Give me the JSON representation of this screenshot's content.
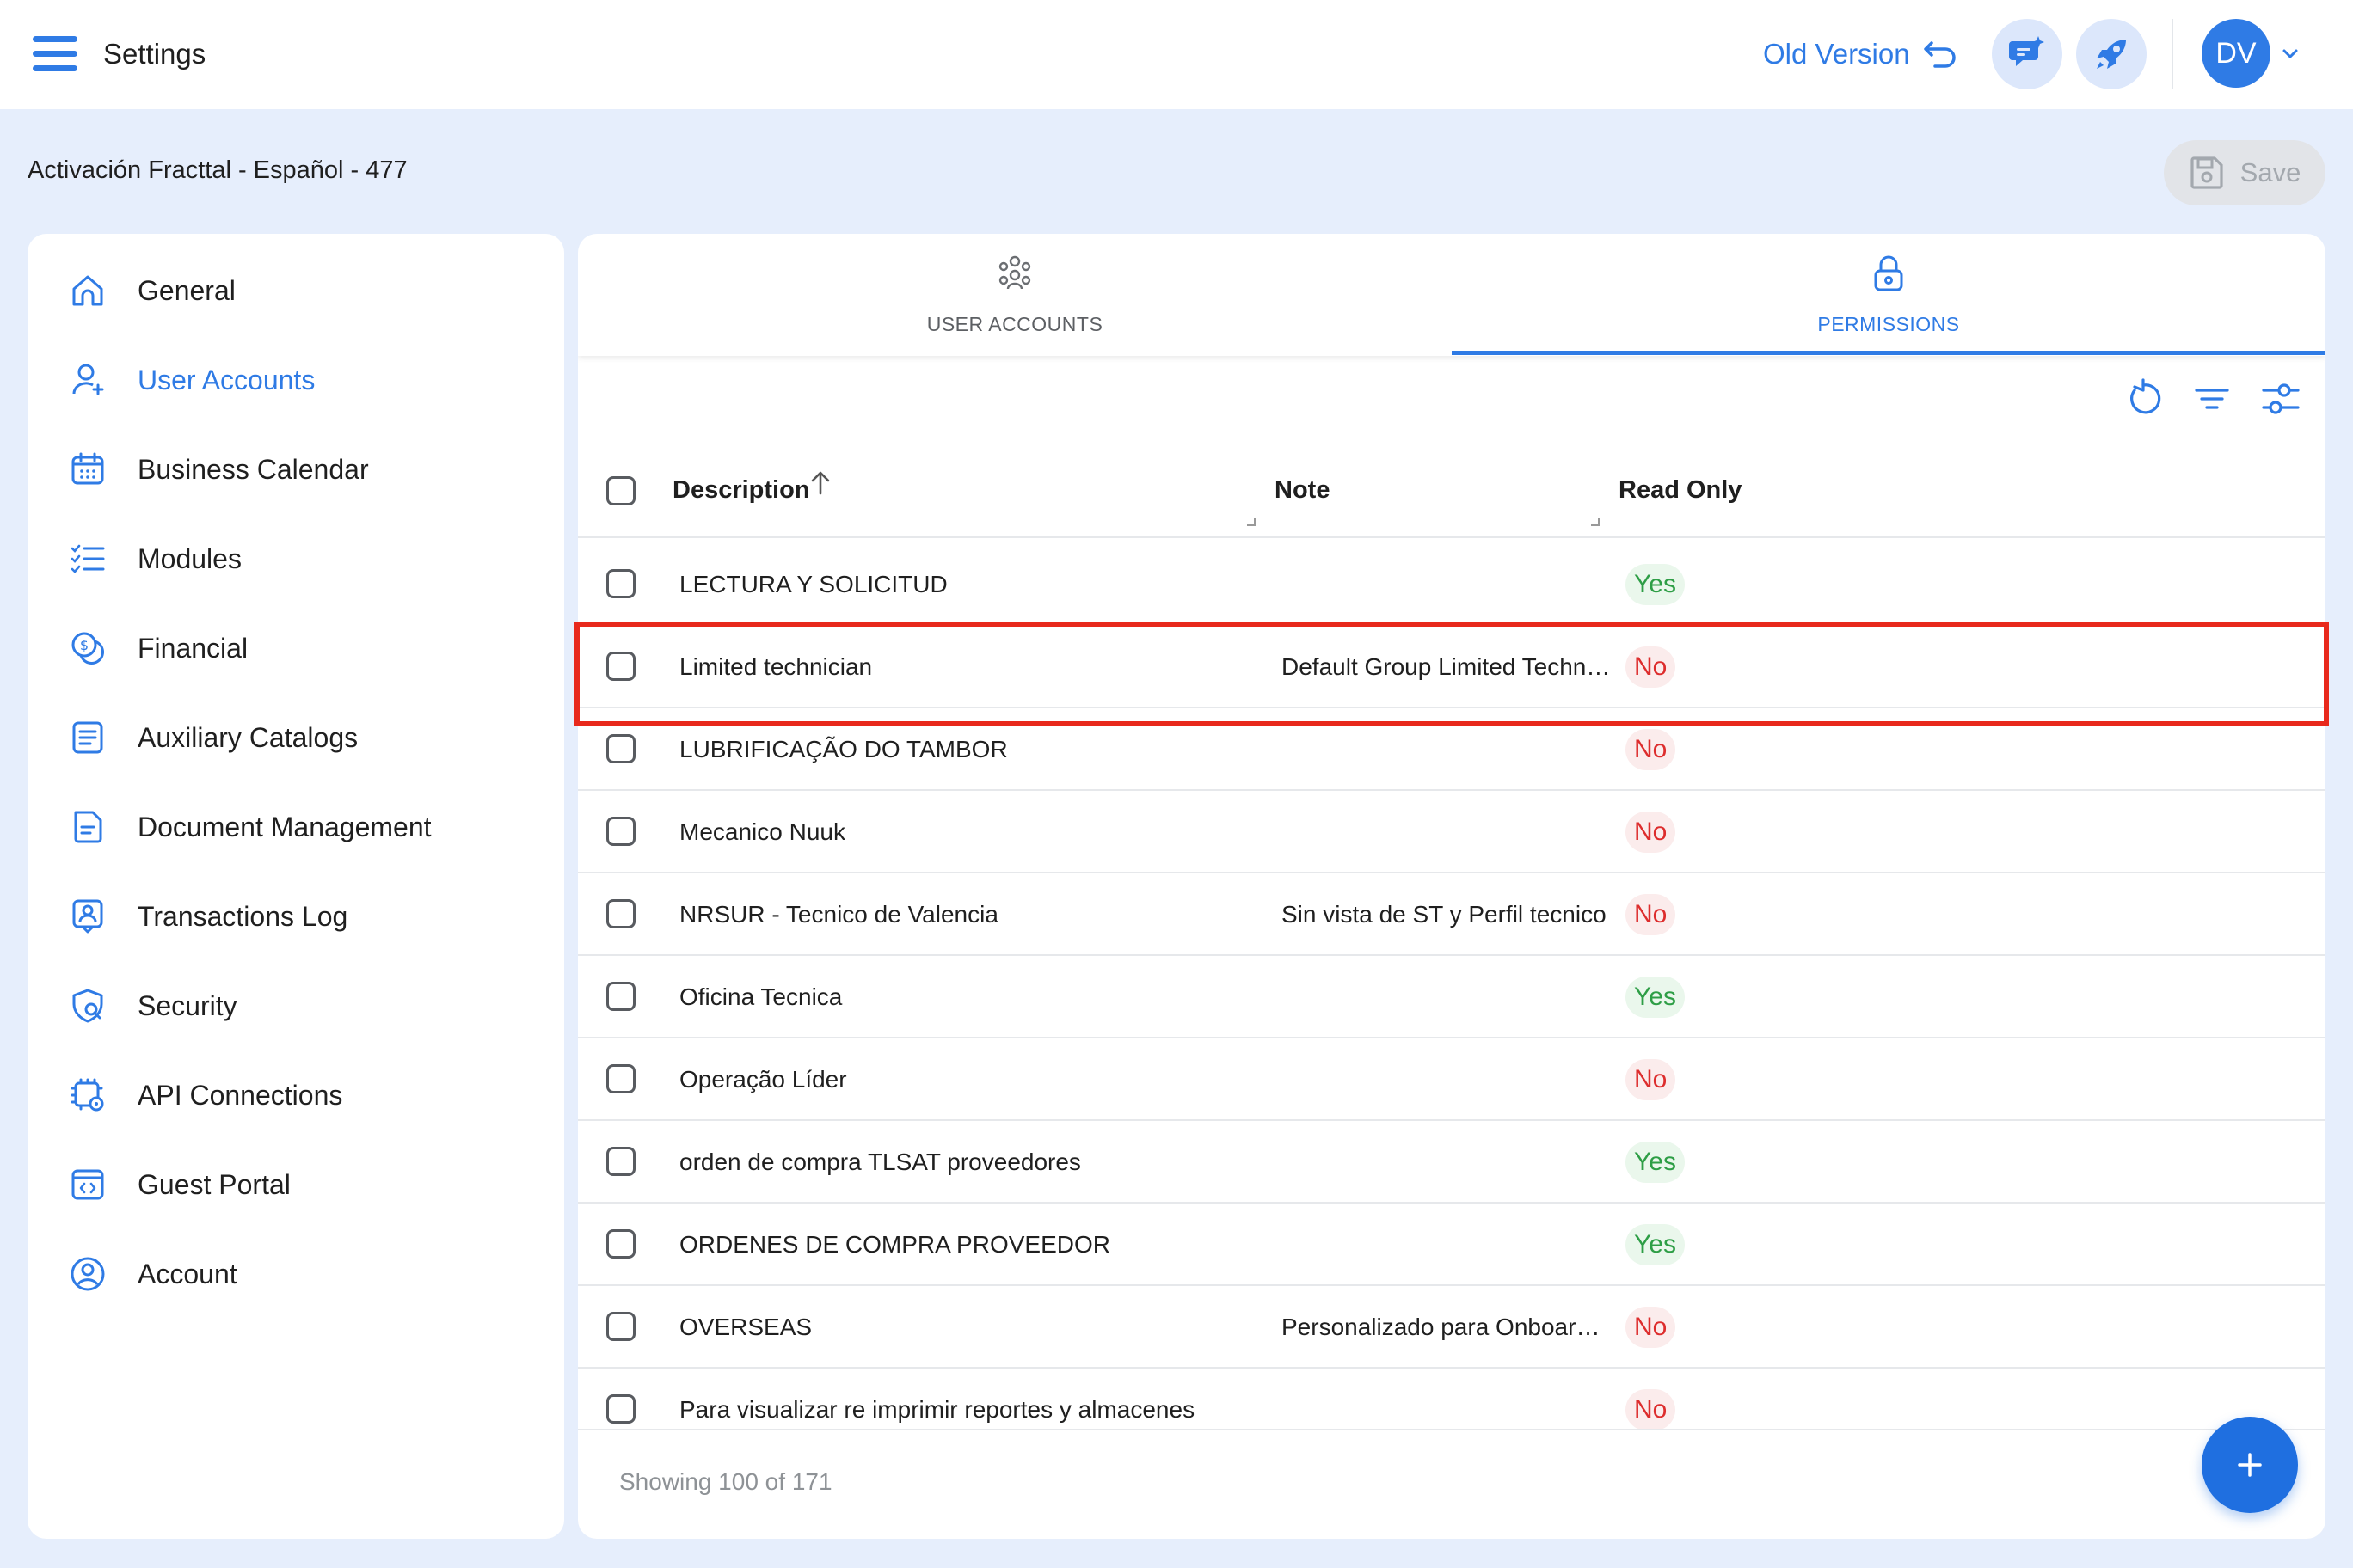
{
  "header": {
    "title": "Settings",
    "old_version_label": "Old Version",
    "user_initials": "DV"
  },
  "record": {
    "title": "Activación Fracttal - Español - 477",
    "save_label": "Save"
  },
  "sidebar": {
    "items": [
      {
        "label": "General",
        "icon": "home-icon"
      },
      {
        "label": "User Accounts",
        "icon": "user-add-icon",
        "active": true
      },
      {
        "label": "Business Calendar",
        "icon": "calendar-icon"
      },
      {
        "label": "Modules",
        "icon": "checklist-icon"
      },
      {
        "label": "Financial",
        "icon": "money-icon"
      },
      {
        "label": "Auxiliary Catalogs",
        "icon": "catalog-icon"
      },
      {
        "label": "Document Management",
        "icon": "document-icon"
      },
      {
        "label": "Transactions Log",
        "icon": "log-icon"
      },
      {
        "label": "Security",
        "icon": "shield-icon"
      },
      {
        "label": "API Connections",
        "icon": "api-gear-icon"
      },
      {
        "label": "Guest Portal",
        "icon": "portal-icon"
      },
      {
        "label": "Account",
        "icon": "account-icon"
      }
    ]
  },
  "tabs": [
    {
      "label": "USER ACCOUNTS",
      "icon": "group-icon"
    },
    {
      "label": "PERMISSIONS",
      "icon": "lock-icon",
      "active": true
    }
  ],
  "table": {
    "columns": {
      "description": "Description",
      "note": "Note",
      "read_only": "Read Only"
    },
    "rows": [
      {
        "description": "LECTURA Y SOLICITUD",
        "note": "",
        "read_only": "Yes"
      },
      {
        "description": "Limited technician",
        "note": "Default Group Limited Technician",
        "read_only": "No",
        "highlighted": true
      },
      {
        "description": "LUBRIFICAÇÃO DO TAMBOR",
        "note": "",
        "read_only": "No"
      },
      {
        "description": "Mecanico Nuuk",
        "note": "",
        "read_only": "No"
      },
      {
        "description": "NRSUR - Tecnico de Valencia",
        "note": "Sin vista de ST y Perfil tecnico",
        "read_only": "No"
      },
      {
        "description": "Oficina Tecnica",
        "note": "",
        "read_only": "Yes"
      },
      {
        "description": "Operação Líder",
        "note": "",
        "read_only": "No"
      },
      {
        "description": "orden de compra TLSAT proveedores",
        "note": "",
        "read_only": "Yes"
      },
      {
        "description": "ORDENES DE COMPRA PROVEEDOR",
        "note": "",
        "read_only": "Yes"
      },
      {
        "description": "OVERSEAS",
        "note": "Personalizado para Onboarding",
        "read_only": "No"
      },
      {
        "description": "Para visualizar re imprimir reportes y almacenes",
        "note": "",
        "read_only": "No"
      }
    ],
    "footer": "Showing 100 of 171"
  },
  "colors": {
    "accent": "#2f7be5",
    "yes": "#2e9e46",
    "no": "#dd2d2d",
    "highlight": "#e8291c"
  }
}
